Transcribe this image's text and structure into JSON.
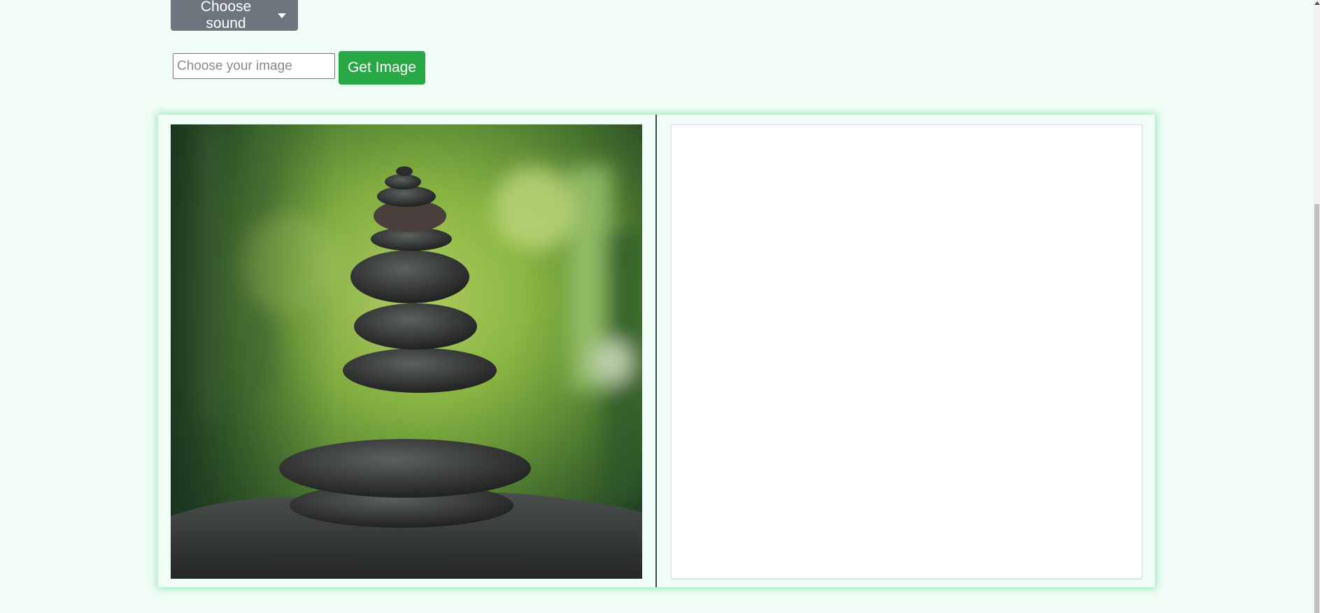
{
  "controls": {
    "sound_dropdown_label": "Choose sound",
    "image_input_value": "",
    "image_input_placeholder": "Choose your image",
    "get_image_label": "Get Image"
  },
  "panels": {
    "left_image_subject": "stacked stones on rock with green blurred background",
    "right_canvas_state": "blank"
  },
  "colors": {
    "page_background": "#f0fdf6",
    "dropdown_button": "#6c757d",
    "get_image_button": "#28a745",
    "frame_glow": "#7adea0",
    "divider": "#3a4a44"
  },
  "icons": {
    "dropdown_caret": "chevron-down-icon",
    "scroll_up": "arrow-up-icon"
  }
}
